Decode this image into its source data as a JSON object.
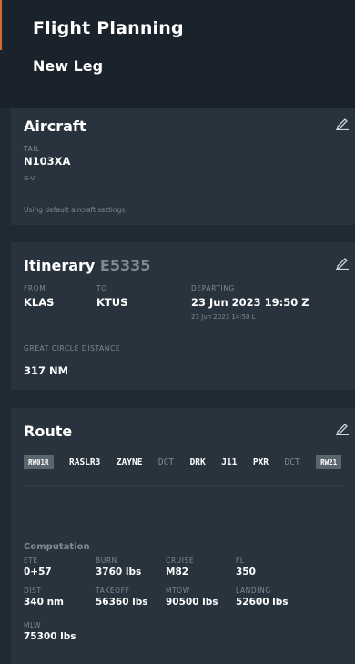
{
  "header": {
    "title": "Flight Planning",
    "subtitle": "New Leg"
  },
  "aircraft": {
    "title": "Aircraft",
    "tail_label": "TAIL",
    "tail": "N103XA",
    "type": "G-V",
    "note": "Using default aircraft settings"
  },
  "itinerary": {
    "title": "Itinerary",
    "code": "E5335",
    "from_label": "FROM",
    "from": "KLAS",
    "to_label": "TO",
    "to": "KTUS",
    "departing_label": "DEPARTING",
    "departing_utc": "23 Jun 2023 19:50 Z",
    "departing_local": "23 Jun 2023 14:50 L",
    "gcd_label": "GREAT CIRCLE DISTANCE",
    "gcd": "317 NM"
  },
  "route": {
    "title": "Route",
    "runway_dep": "RW01R",
    "segments": [
      {
        "text": "RASLR3",
        "muted": false
      },
      {
        "text": "ZAYNE",
        "muted": false
      },
      {
        "text": "DCT",
        "muted": true
      },
      {
        "text": "DRK",
        "muted": false
      },
      {
        "text": "J11",
        "muted": false
      },
      {
        "text": "PXR",
        "muted": false
      },
      {
        "text": "DCT",
        "muted": true
      }
    ],
    "runway_arr": "RW21"
  },
  "computation": {
    "title": "Computation",
    "items": [
      {
        "label": "ETE",
        "value": "0+57"
      },
      {
        "label": "BURN",
        "value": "3760 lbs"
      },
      {
        "label": "CRUISE",
        "value": "M82"
      },
      {
        "label": "FL",
        "value": "350"
      },
      {
        "label": "DIST",
        "value": "340 nm"
      },
      {
        "label": "TAKEOFF",
        "value": "56360 lbs"
      },
      {
        "label": "MTOW",
        "value": "90500 lbs"
      },
      {
        "label": "LANDING",
        "value": "52600 lbs"
      },
      {
        "label": "MLW",
        "value": "75300 lbs"
      }
    ]
  },
  "colors": {
    "accent": "#d06a2e",
    "background": "#1f2a33",
    "panel": "#28333d",
    "muted_text": "#7d8994"
  }
}
